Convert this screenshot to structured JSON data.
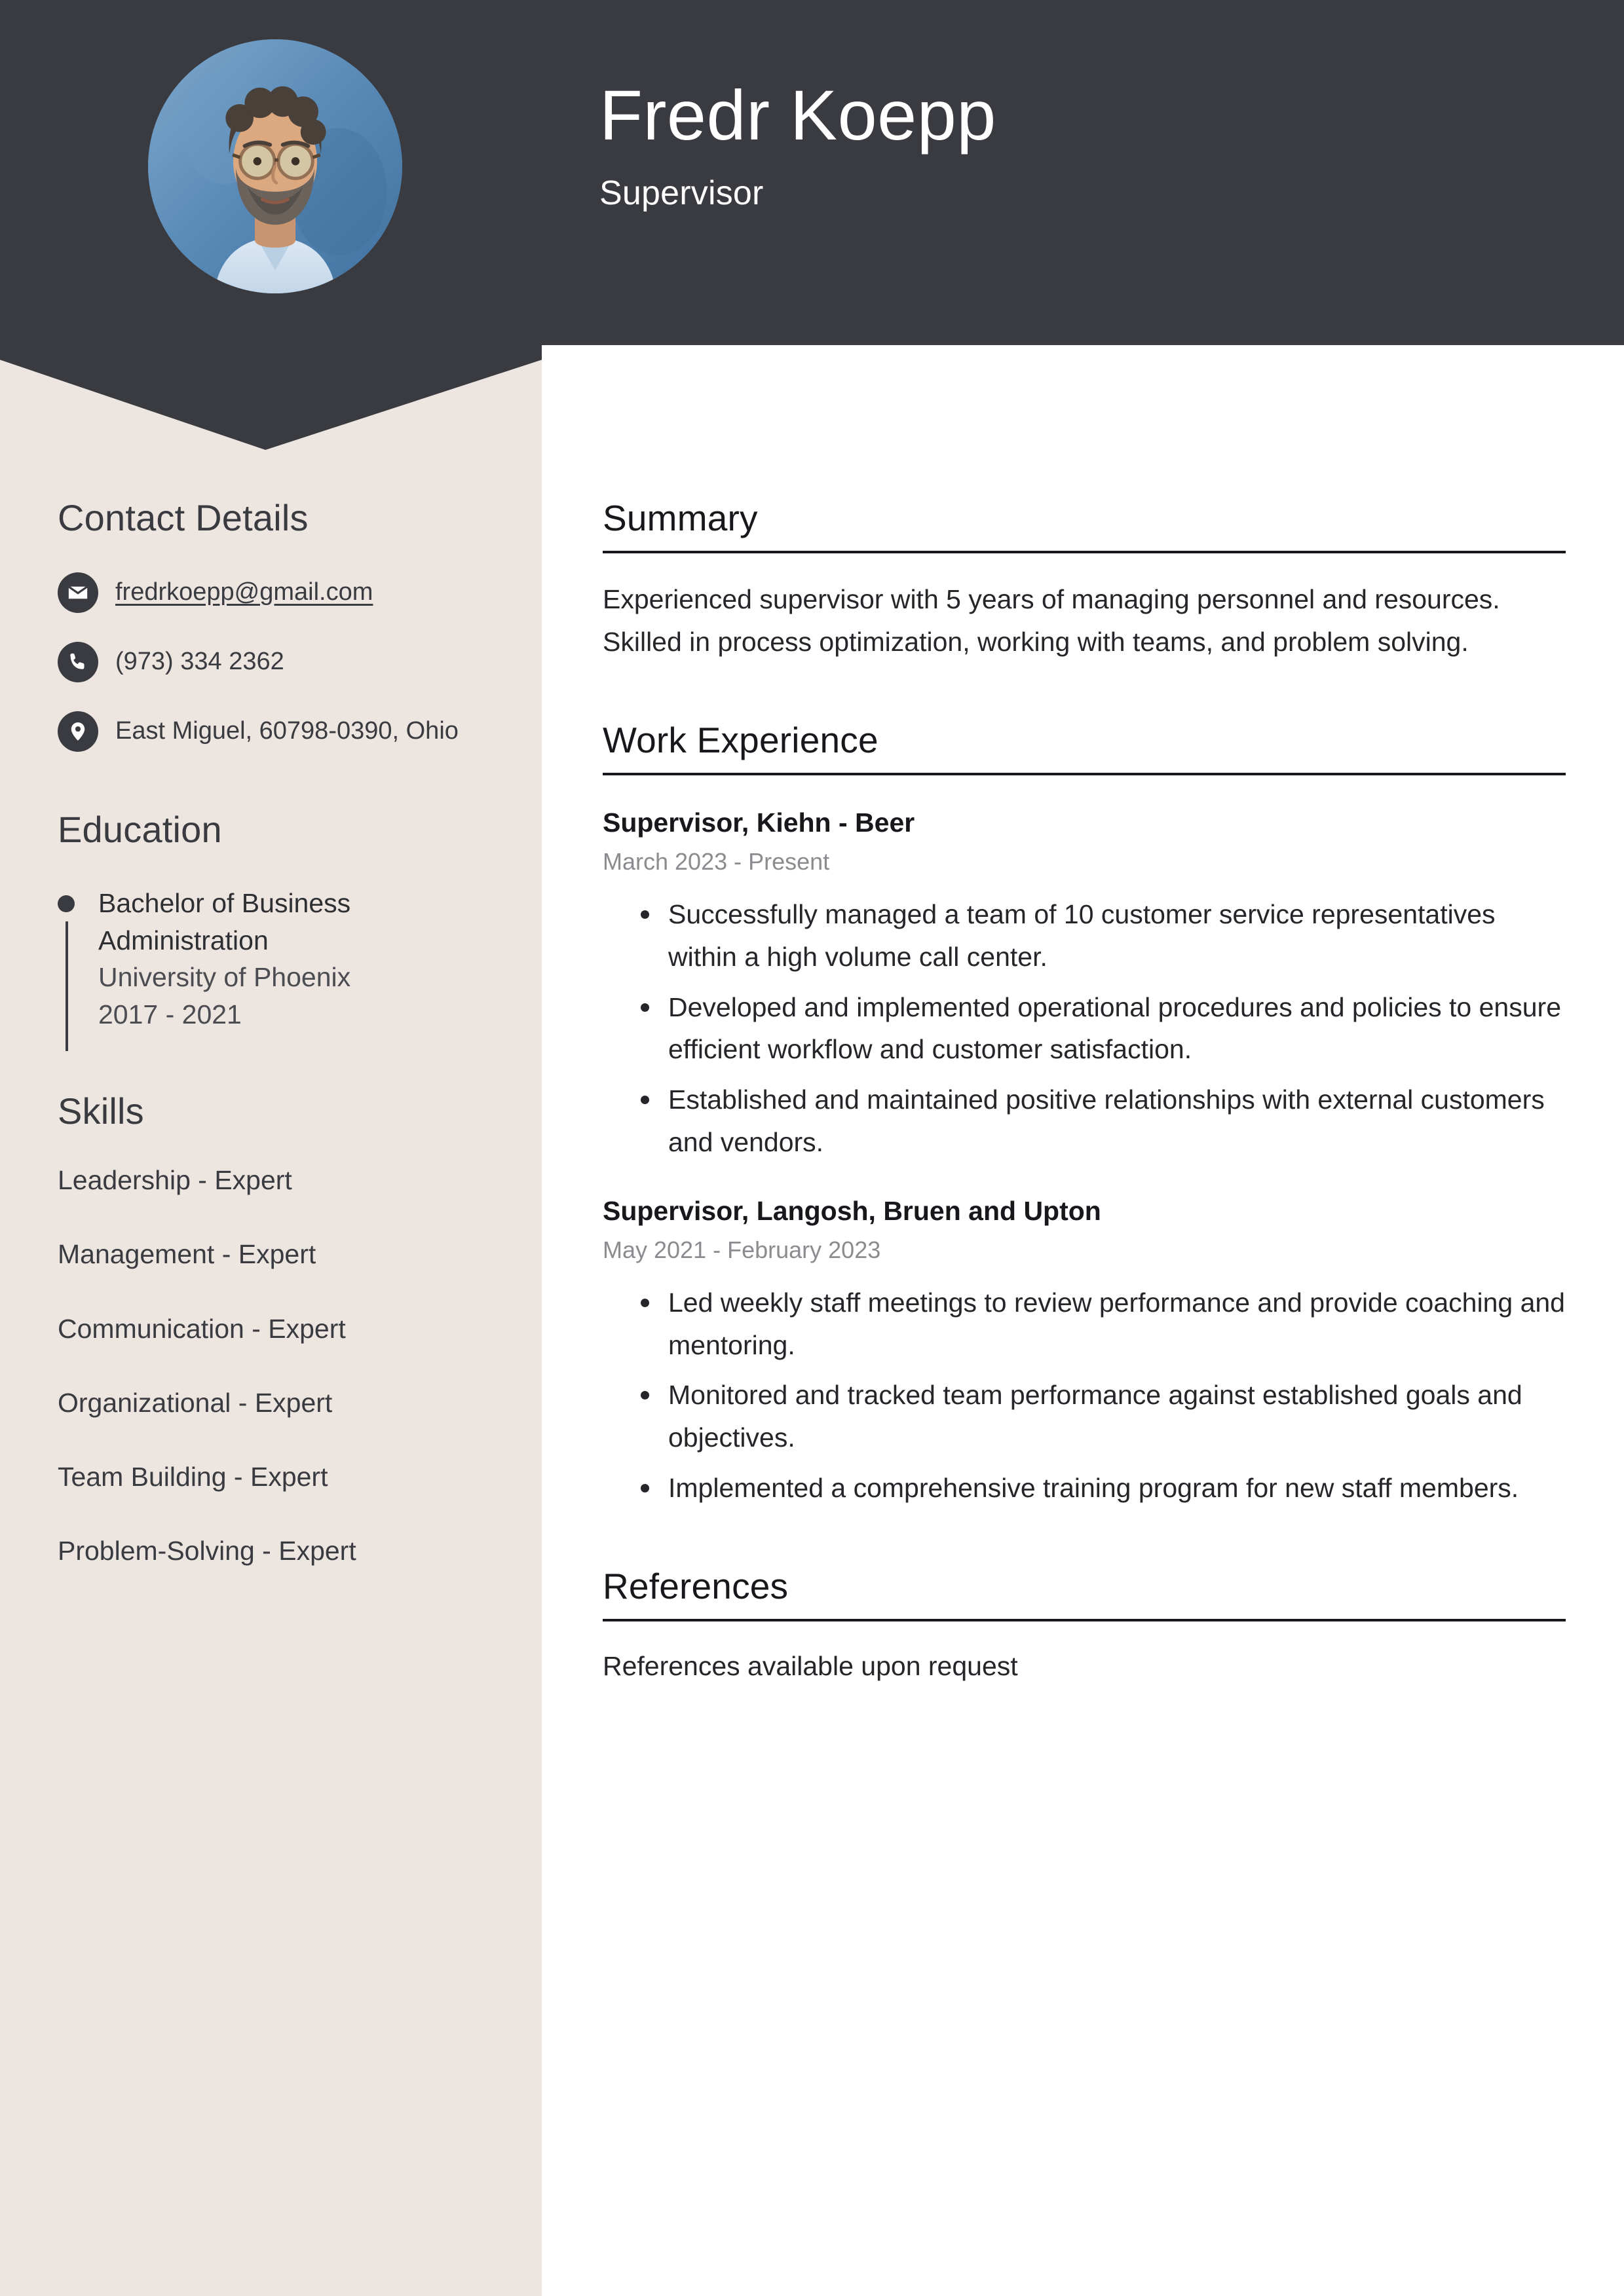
{
  "theme": {
    "dark": "#3A3B40",
    "beige": "#EDE5E0",
    "white": "#FFFFFF",
    "muted_date": "#8C8C90",
    "body_text": "#25262A"
  },
  "header": {
    "name": "Fredr Koepp",
    "role": "Supervisor",
    "avatar_alt": "profile-photo"
  },
  "sidebar": {
    "contact": {
      "heading": "Contact Details",
      "items": [
        {
          "icon": "envelope-icon",
          "text": "fredrkoepp@gmail.com",
          "is_link": true
        },
        {
          "icon": "phone-icon",
          "text": "(973) 334 2362",
          "is_link": false
        },
        {
          "icon": "location-pin-icon",
          "text": "East Miguel, 60798-0390, Ohio",
          "is_link": false
        }
      ]
    },
    "education": {
      "heading": "Education",
      "items": [
        {
          "degree": "Bachelor of Business Administration",
          "school": "University of Phoenix",
          "years": "2017 - 2021"
        }
      ]
    },
    "skills": {
      "heading": "Skills",
      "items": [
        "Leadership - Expert",
        "Management - Expert",
        "Communication - Expert",
        "Organizational - Expert",
        "Team Building - Expert",
        "Problem-Solving - Expert"
      ]
    }
  },
  "main": {
    "summary": {
      "heading": "Summary",
      "body": "Experienced supervisor with 5 years of managing personnel and resources. Skilled in process optimization, working with teams, and problem solving."
    },
    "work_experience": {
      "heading": "Work Experience",
      "jobs": [
        {
          "title": "Supervisor, Kiehn - Beer",
          "dates": "March 2023 - Present",
          "bullets": [
            "Successfully managed a team of 10 customer service representatives within a high volume call center.",
            "Developed and implemented operational procedures and policies to ensure efficient workflow and customer satisfaction.",
            "Established and maintained positive relationships with external customers and vendors."
          ]
        },
        {
          "title": "Supervisor, Langosh, Bruen and Upton",
          "dates": "May 2021 - February 2023",
          "bullets": [
            "Led weekly staff meetings to review performance and provide coaching and mentoring.",
            "Monitored and tracked team performance against established goals and objectives.",
            "Implemented a comprehensive training program for new staff members."
          ]
        }
      ]
    },
    "references": {
      "heading": "References",
      "body": "References available upon request"
    }
  }
}
